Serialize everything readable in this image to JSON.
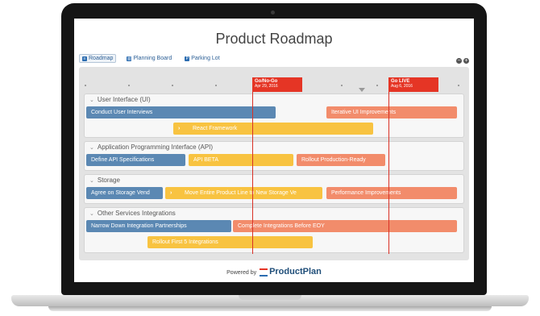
{
  "title": "Product Roadmap",
  "nav": {
    "roadmap": "Roadmap",
    "planning": "Planning Board",
    "parking": "Parking Lot"
  },
  "milestones": [
    {
      "name": "Go/No-Go",
      "date": "Apr 29, 2016"
    },
    {
      "name": "Go LIVE",
      "date": "Aug 6, 2016"
    }
  ],
  "lanes": {
    "ui": {
      "title": "User Interface (UI)",
      "bars": [
        "Conduct User Interviews",
        "Iterative UI Improvements",
        "React Framework"
      ]
    },
    "api": {
      "title": "Application Programming Interface (API)",
      "bars": [
        "Define API Specifications",
        "API BETA",
        "Rollout Production-Ready"
      ]
    },
    "storage": {
      "title": "Storage",
      "bars": [
        "Agree on Storage Vend",
        "Move Entire Product Line to New Storage Ve",
        "Performance Improvements"
      ]
    },
    "other": {
      "title": "Other Services Integrations",
      "bars": [
        "Narrow Down Integration Partnerships",
        "Complete Integrations Before EOY",
        "Rollout First 5 Integrations"
      ]
    }
  },
  "footer": {
    "powered": "Powered by",
    "brand": "ProductPlan"
  },
  "colors": {
    "blue": "#5b88b3",
    "yellow": "#f8c341",
    "orange": "#f28c6b",
    "milestone": "#e53525"
  }
}
